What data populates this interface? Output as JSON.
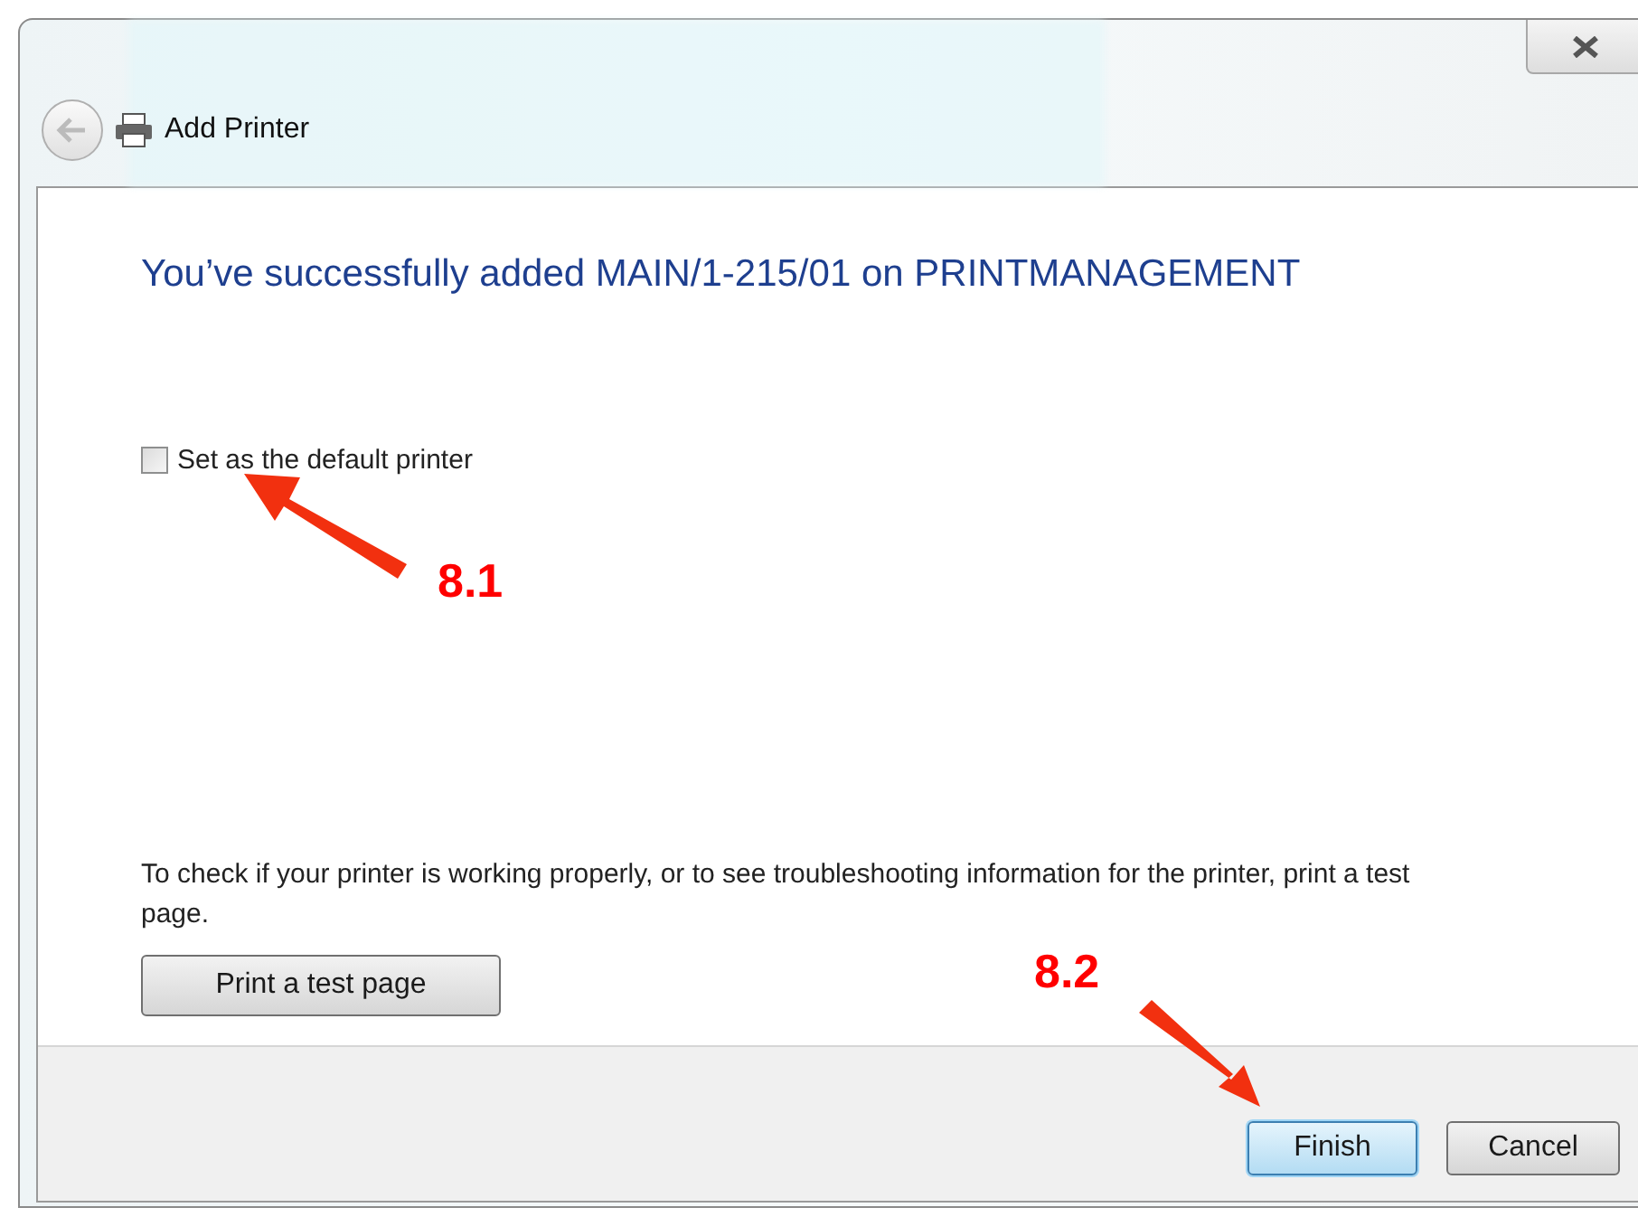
{
  "window": {
    "title": "Add Printer"
  },
  "heading": "You’ve successfully added MAIN/1-215/01 on PRINTMANAGEMENT",
  "default_printer": {
    "label": "Set as the default printer",
    "checked": false
  },
  "info_text": "To check if your printer is working properly, or to see troubleshooting information for the printer, print a test page.",
  "test_page_button": "Print a test page",
  "buttons": [
    {
      "label": "Finish",
      "default": true
    },
    {
      "label": "Cancel",
      "default": false
    }
  ],
  "annotations": [
    {
      "label": "8.1"
    },
    {
      "label": "8.2"
    }
  ]
}
